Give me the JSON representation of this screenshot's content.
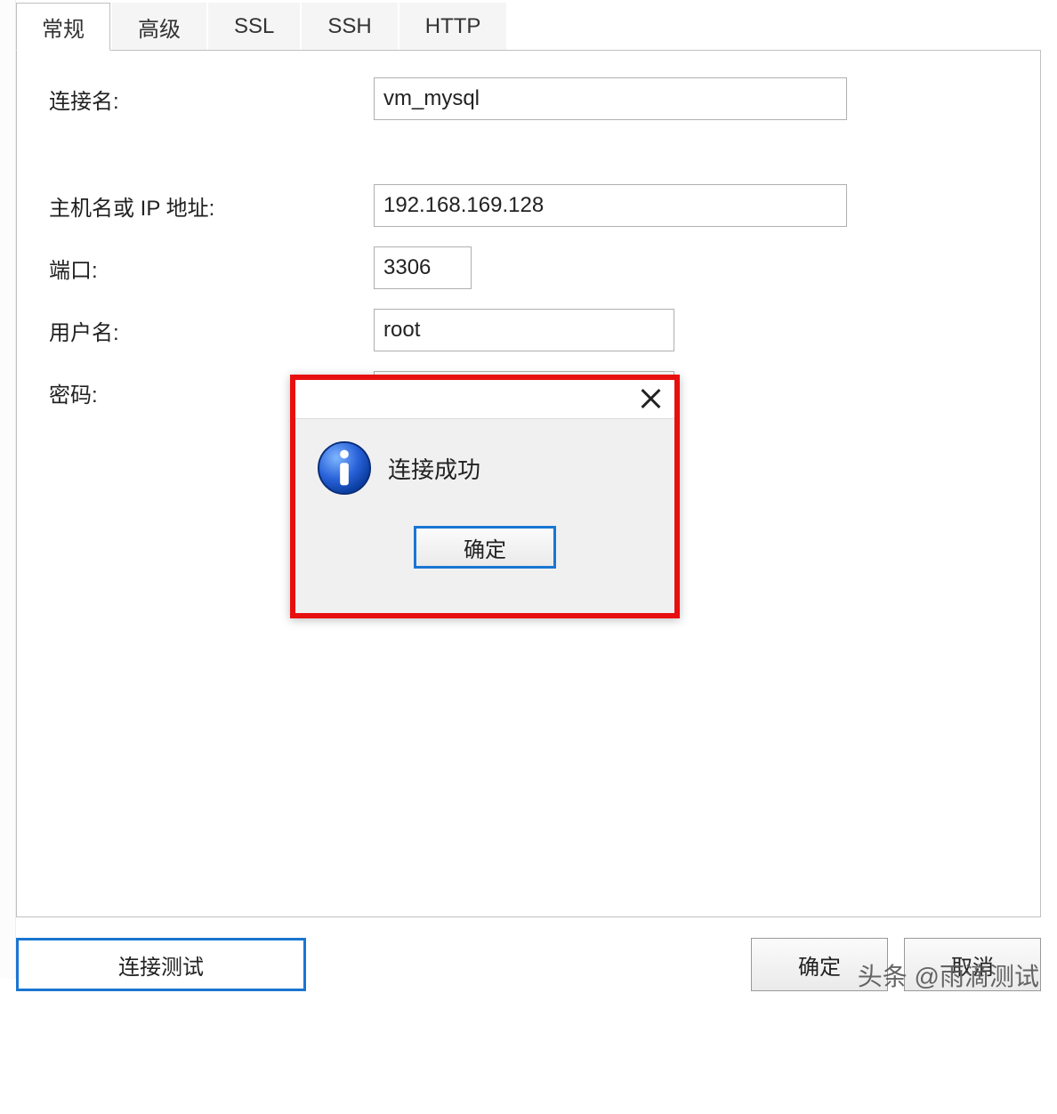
{
  "tabs": {
    "general": "常规",
    "advanced": "高级",
    "ssl": "SSL",
    "ssh": "SSH",
    "http": "HTTP"
  },
  "form": {
    "connection_name_label": "连接名:",
    "connection_name_value": "vm_mysql",
    "host_label": "主机名或 IP 地址:",
    "host_value": "192.168.169.128",
    "port_label": "端口:",
    "port_value": "3306",
    "user_label": "用户名:",
    "user_value": "root",
    "password_label": "密码:",
    "password_value": "•••••••"
  },
  "buttons": {
    "test_connection": "连接测试",
    "ok": "确定",
    "cancel": "取消"
  },
  "modal": {
    "message": "连接成功",
    "ok": "确定"
  },
  "watermark": "头条 @雨滴测试"
}
